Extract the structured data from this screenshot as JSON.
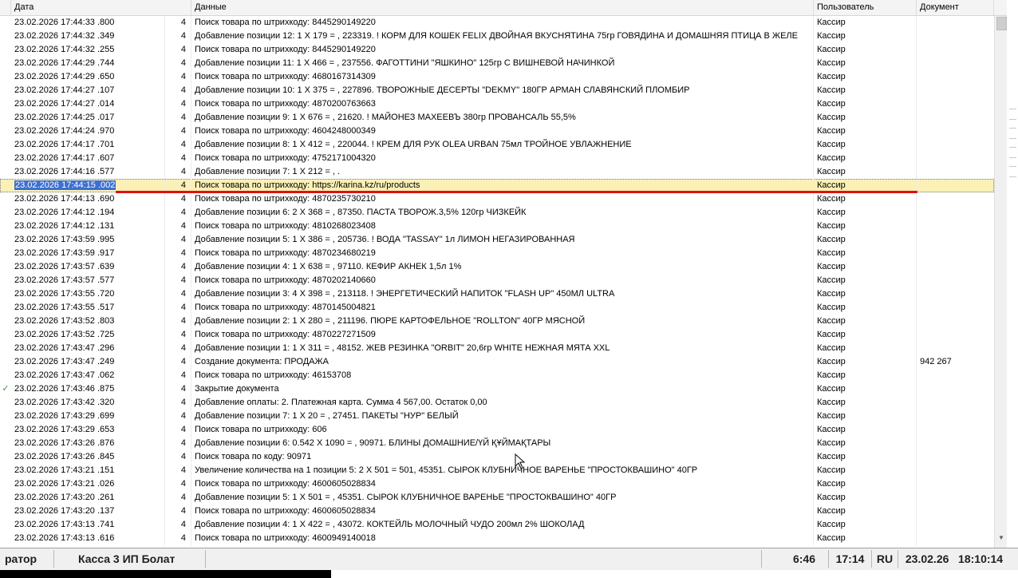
{
  "table": {
    "columns": {
      "date": "Дата",
      "data": "Данные",
      "user": "Пользователь",
      "doc": "Документ"
    },
    "rows": [
      {
        "mark": "",
        "date": "23.02.2026  17:44:33 .800",
        "level": "4",
        "data": "Поиск товара по штрихкоду: 8445290149220",
        "user": "Кассир",
        "doc": ""
      },
      {
        "mark": "",
        "date": "23.02.2026  17:44:32 .349",
        "level": "4",
        "data": "Добавление позиции 12: 1 X 179 = , 223319. ! КОРМ ДЛЯ КОШЕК FELIX ДВОЙНАЯ ВКУСНЯТИНА 75гр ГОВЯДИНА И ДОМАШНЯЯ ПТИЦА В ЖЕЛЕ",
        "user": "Кассир",
        "doc": ""
      },
      {
        "mark": "",
        "date": "23.02.2026  17:44:32 .255",
        "level": "4",
        "data": "Поиск товара по штрихкоду: 8445290149220",
        "user": "Кассир",
        "doc": ""
      },
      {
        "mark": "",
        "date": "23.02.2026  17:44:29 .744",
        "level": "4",
        "data": "Добавление позиции 11: 1 X 466 = , 237556. ФАГОТТИНИ \"ЯШКИНО\" 125гр С ВИШНЕВОЙ НАЧИНКОЙ",
        "user": "Кассир",
        "doc": ""
      },
      {
        "mark": "",
        "date": "23.02.2026  17:44:29 .650",
        "level": "4",
        "data": "Поиск товара по штрихкоду: 4680167314309",
        "user": "Кассир",
        "doc": ""
      },
      {
        "mark": "",
        "date": "23.02.2026  17:44:27 .107",
        "level": "4",
        "data": "Добавление позиции 10: 1 X 375 = , 227896. ТВОРОЖНЫЕ ДЕСЕРТЫ \"DEKMY\" 180ГР АРМАН СЛАВЯНСКИЙ ПЛОМБИР",
        "user": "Кассир",
        "doc": ""
      },
      {
        "mark": "",
        "date": "23.02.2026  17:44:27 .014",
        "level": "4",
        "data": "Поиск товара по штрихкоду: 4870200763663",
        "user": "Кассир",
        "doc": ""
      },
      {
        "mark": "",
        "date": "23.02.2026  17:44:25 .017",
        "level": "4",
        "data": "Добавление позиции 9: 1 X 676 = , 21620. ! МАЙОНЕЗ МАХЕЕВЪ 380гр ПРОВАНСАЛЬ 55,5%",
        "user": "Кассир",
        "doc": ""
      },
      {
        "mark": "",
        "date": "23.02.2026  17:44:24 .970",
        "level": "4",
        "data": "Поиск товара по штрихкоду: 4604248000349",
        "user": "Кассир",
        "doc": ""
      },
      {
        "mark": "",
        "date": "23.02.2026  17:44:17 .701",
        "level": "4",
        "data": "Добавление позиции 8: 1 X 412 = , 220044. ! КРЕМ ДЛЯ РУК OLEA URBAN 75мл ТРОЙНОЕ УВЛАЖНЕНИЕ",
        "user": "Кассир",
        "doc": ""
      },
      {
        "mark": "",
        "date": "23.02.2026  17:44:17 .607",
        "level": "4",
        "data": "Поиск товара по штрихкоду: 4752171004320",
        "user": "Кассир",
        "doc": ""
      },
      {
        "mark": "",
        "date": "23.02.2026  17:44:16 .577",
        "level": "4",
        "data": "Добавление позиции 7: 1 X 212 = , .",
        "user": "Кассир",
        "doc": ""
      },
      {
        "mark": "",
        "date": "23.02.2026  17:44:15 .002",
        "level": "4",
        "data": "Поиск товара по штрихкоду: https://karina.kz/ru/products",
        "user": "Кассир",
        "doc": ""
      },
      {
        "mark": "",
        "date": "23.02.2026  17:44:13 .690",
        "level": "4",
        "data": "Поиск товара по штрихкоду: 4870235730210",
        "user": "Кассир",
        "doc": ""
      },
      {
        "mark": "",
        "date": "23.02.2026  17:44:12 .194",
        "level": "4",
        "data": "Добавление позиции 6: 2 X 368 = , 87350. ПАСТА ТВОРОЖ.3,5% 120гр ЧИЗКЕЙК",
        "user": "Кассир",
        "doc": ""
      },
      {
        "mark": "",
        "date": "23.02.2026  17:44:12 .131",
        "level": "4",
        "data": "Поиск товара по штрихкоду: 4810268023408",
        "user": "Кассир",
        "doc": ""
      },
      {
        "mark": "",
        "date": "23.02.2026  17:43:59 .995",
        "level": "4",
        "data": "Добавление позиции 5: 1 X 386 = , 205736. ! ВОДА \"TASSAY\" 1л ЛИМОН НЕГАЗИРОВАННАЯ",
        "user": "Кассир",
        "doc": ""
      },
      {
        "mark": "",
        "date": "23.02.2026  17:43:59 .917",
        "level": "4",
        "data": "Поиск товара по штрихкоду: 4870234680219",
        "user": "Кассир",
        "doc": ""
      },
      {
        "mark": "",
        "date": "23.02.2026  17:43:57 .639",
        "level": "4",
        "data": "Добавление позиции 4: 1 X 638 = , 97110. КЕФИР АКНЕК 1,5л 1%",
        "user": "Кассир",
        "doc": ""
      },
      {
        "mark": "",
        "date": "23.02.2026  17:43:57 .577",
        "level": "4",
        "data": "Поиск товара по штрихкоду: 4870202140660",
        "user": "Кассир",
        "doc": ""
      },
      {
        "mark": "",
        "date": "23.02.2026  17:43:55 .720",
        "level": "4",
        "data": "Добавление позиции 3: 4 X 398 = , 213118. ! ЭНЕРГЕТИЧЕСКИЙ НАПИТОК \"FLASH UP\" 450МЛ ULTRA",
        "user": "Кассир",
        "doc": ""
      },
      {
        "mark": "",
        "date": "23.02.2026  17:43:55 .517",
        "level": "4",
        "data": "Поиск товара по штрихкоду: 4870145004821",
        "user": "Кассир",
        "doc": ""
      },
      {
        "mark": "",
        "date": "23.02.2026  17:43:52 .803",
        "level": "4",
        "data": "Добавление позиции 2: 1 X 280 = , 211196. ПЮРЕ КАРТОФЕЛЬНОЕ \"ROLLTON\" 40ГР МЯСНОЙ",
        "user": "Кассир",
        "doc": ""
      },
      {
        "mark": "",
        "date": "23.02.2026  17:43:52 .725",
        "level": "4",
        "data": "Поиск товара по штрихкоду: 4870227271509",
        "user": "Кассир",
        "doc": ""
      },
      {
        "mark": "",
        "date": "23.02.2026  17:43:47 .296",
        "level": "4",
        "data": "Добавление позиции 1: 1 X 311 = , 48152. ЖЕВ РЕЗИНКА \"ORBIT\" 20,6гр WHITE НЕЖНАЯ МЯТА XXL",
        "user": "Кассир",
        "doc": ""
      },
      {
        "mark": "",
        "date": "23.02.2026  17:43:47 .249",
        "level": "4",
        "data": "Создание документа: ПРОДАЖА",
        "user": "Кассир",
        "doc": "942 267"
      },
      {
        "mark": "",
        "date": "23.02.2026  17:43:47 .062",
        "level": "4",
        "data": "Поиск товара по штрихкоду: 46153708",
        "user": "Кассир",
        "doc": ""
      },
      {
        "mark": "✓",
        "date": "23.02.2026  17:43:46 .875",
        "level": "4",
        "data": "Закрытие документа",
        "user": "Кассир",
        "doc": ""
      },
      {
        "mark": "",
        "date": "23.02.2026  17:43:42 .320",
        "level": "4",
        "data": "Добавление оплаты: 2. Платежная карта. Сумма 4 567,00. Остаток 0,00",
        "user": "Кассир",
        "doc": ""
      },
      {
        "mark": "",
        "date": "23.02.2026  17:43:29 .699",
        "level": "4",
        "data": "Добавление позиции 7: 1 X 20 = , 27451. ПАКЕТЫ  \"НУР\" БЕЛЫЙ",
        "user": "Кассир",
        "doc": ""
      },
      {
        "mark": "",
        "date": "23.02.2026  17:43:29 .653",
        "level": "4",
        "data": "Поиск товара по штрихкоду: 606",
        "user": "Кассир",
        "doc": ""
      },
      {
        "mark": "",
        "date": "23.02.2026  17:43:26 .876",
        "level": "4",
        "data": "Добавление позиции 6: 0.542 X 1090 = , 90971. БЛИНЫ ДОМАШНИЕ/ҮЙ ҚҰЙМАҚТАРЫ",
        "user": "Кассир",
        "doc": ""
      },
      {
        "mark": "",
        "date": "23.02.2026  17:43:26 .845",
        "level": "4",
        "data": "Поиск товара по коду: 90971",
        "user": "Кассир",
        "doc": ""
      },
      {
        "mark": "",
        "date": "23.02.2026  17:43:21 .151",
        "level": "4",
        "data": "Увеличение количества на 1 позиции 5: 2 X 501 = 501, 45351. СЫРОК КЛУБНИЧНОЕ ВАРЕНЬЕ  \"ПРОСТОКВАШИНО\" 40ГР",
        "user": "Кассир",
        "doc": ""
      },
      {
        "mark": "",
        "date": "23.02.2026  17:43:21 .026",
        "level": "4",
        "data": "Поиск товара по штрихкоду: 4600605028834",
        "user": "Кассир",
        "doc": ""
      },
      {
        "mark": "",
        "date": "23.02.2026  17:43:20 .261",
        "level": "4",
        "data": "Добавление позиции 5: 1 X 501 = , 45351. СЫРОК КЛУБНИЧНОЕ ВАРЕНЬЕ  \"ПРОСТОКВАШИНО\" 40ГР",
        "user": "Кассир",
        "doc": ""
      },
      {
        "mark": "",
        "date": "23.02.2026  17:43:20 .137",
        "level": "4",
        "data": "Поиск товара по штрихкоду: 4600605028834",
        "user": "Кассир",
        "doc": ""
      },
      {
        "mark": "",
        "date": "23.02.2026  17:43:13 .741",
        "level": "4",
        "data": "Добавление позиции 4: 1 X 422 = , 43072. КОКТЕЙЛЬ МОЛОЧНЫЙ ЧУДО 200мл 2% ШОКОЛАД",
        "user": "Кассир",
        "doc": ""
      },
      {
        "mark": "",
        "date": "23.02.2026  17:43:13 .616",
        "level": "4",
        "data": "Поиск товара по штрихкоду: 4600949140018",
        "user": "Кассир",
        "doc": ""
      }
    ],
    "selected_index": 12
  },
  "statusbar": {
    "operator": "ратор",
    "register": "Касса 3 ИП Болат",
    "empty": "",
    "timer": "6:46",
    "time": "17:14",
    "lang": "RU",
    "datetime": "23.02.26   18:10:14"
  },
  "colors": {
    "selected_row": "#fbf0b6",
    "underline": "#e01010",
    "selection_text_bg": "#3d6fd1",
    "mark": "#3a9a3a"
  },
  "icons": {
    "scroll_up": "chevron-up-icon",
    "scroll_down": "chevron-down-icon",
    "mark": "checkmark-icon",
    "cursor": "mouse-pointer-icon"
  }
}
